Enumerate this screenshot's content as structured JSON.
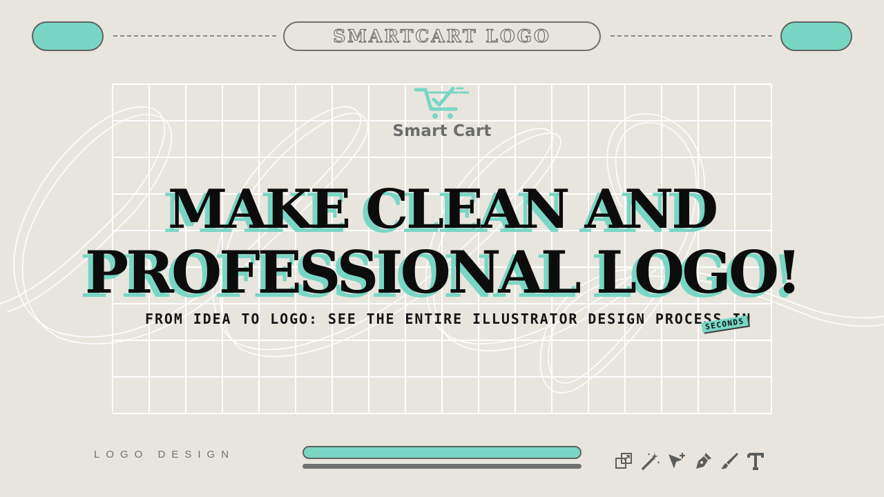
{
  "header": {
    "title": "SMARTCART LOGO"
  },
  "brand": {
    "name": "Smart Cart",
    "icon": "shopping-cart-check-icon",
    "accent_color": "#79d6c4",
    "text_color": "#6b6d6b"
  },
  "headline": {
    "line1": "MAKE CLEAN AND",
    "line2": "PROFESSIONAL LOGO!",
    "shadow_color": "#79d6c4"
  },
  "subtitle": {
    "text": "FROM IDEA TO LOGO: SEE THE ENTIRE ILLUSTRATOR DESIGN PROCESS IN",
    "badge": "SECONDS"
  },
  "footer": {
    "label": "LOGO DESIGN",
    "tools": [
      "artboard-icon",
      "magic-wand-icon",
      "direct-selection-icon",
      "pen-tool-icon",
      "brush-icon",
      "type-tool-icon"
    ]
  },
  "colors": {
    "background": "#e8e5df",
    "accent": "#79d6c4",
    "outline": "#5f625f"
  }
}
